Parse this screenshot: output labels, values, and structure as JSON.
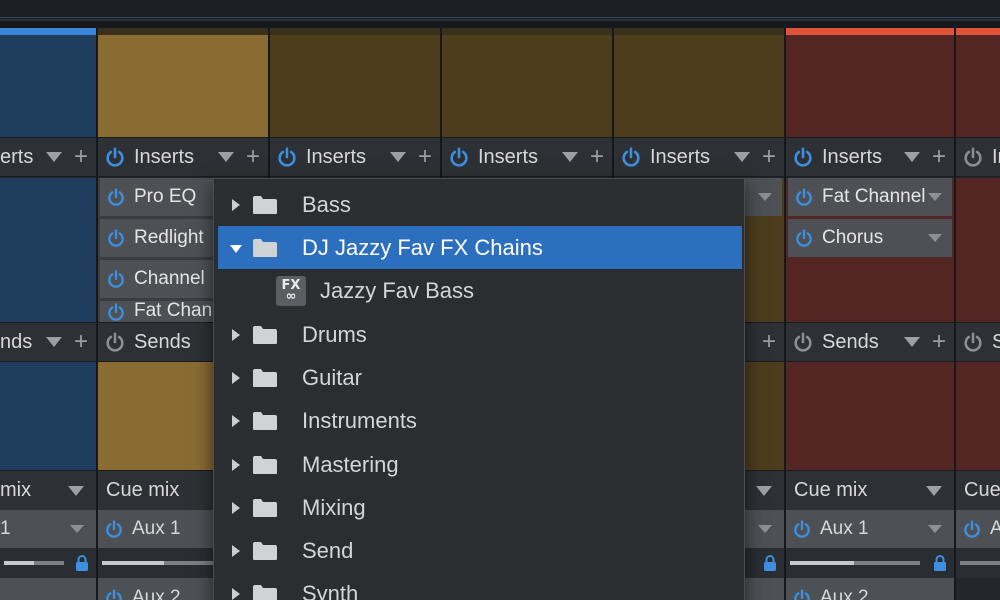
{
  "colors": {
    "blue_channel": "#1f3e5d",
    "gold_light": "#8a6c33",
    "gold_dark": "#4e3d1d",
    "red_channel": "#532624",
    "power_on": "#3d8fe0",
    "power_off": "#8a8f94",
    "menu_selected": "#2d6fbf"
  },
  "channels": [
    {
      "inserts_label": "erts",
      "sends_label": "nds",
      "cue_label": "mix",
      "aux1_label": "1",
      "aux2_label": ""
    },
    {
      "inserts_label": "Inserts",
      "sends_label": "Sends",
      "cue_label": "Cue mix",
      "aux1_label": "Aux 1",
      "aux2_label": "Aux 2",
      "slots": [
        "Pro EQ",
        "Redlight",
        "Channel",
        "Fat Chan"
      ]
    },
    {
      "inserts_label": "Inserts"
    },
    {
      "inserts_label": "Inserts"
    },
    {
      "inserts_label": "Inserts"
    },
    {
      "inserts_label": "Inserts",
      "sends_label": "Sends",
      "cue_label": "Cue mix",
      "aux1_label": "Aux 1",
      "aux2_label": "Aux 2",
      "slots": [
        "Fat Channel",
        "Chorus"
      ]
    },
    {
      "inserts_label": "In",
      "sends_label": "S",
      "cue_label": "Cue",
      "aux1_label": "A"
    }
  ],
  "menu": {
    "items": [
      {
        "label": "Bass",
        "type": "folder",
        "expanded": false
      },
      {
        "label": "DJ Jazzy Fav FX Chains",
        "type": "folder",
        "expanded": true,
        "selected": true
      },
      {
        "label": "Jazzy Fav Bass",
        "type": "fxchain",
        "icon_text_top": "FX",
        "icon_text_bottom": "∞"
      },
      {
        "label": "Drums",
        "type": "folder",
        "expanded": false
      },
      {
        "label": "Guitar",
        "type": "folder",
        "expanded": false
      },
      {
        "label": "Instruments",
        "type": "folder",
        "expanded": false
      },
      {
        "label": "Mastering",
        "type": "folder",
        "expanded": false
      },
      {
        "label": "Mixing",
        "type": "folder",
        "expanded": false
      },
      {
        "label": "Send",
        "type": "folder",
        "expanded": false
      },
      {
        "label": "Synth",
        "type": "folder",
        "expanded": false
      }
    ]
  }
}
